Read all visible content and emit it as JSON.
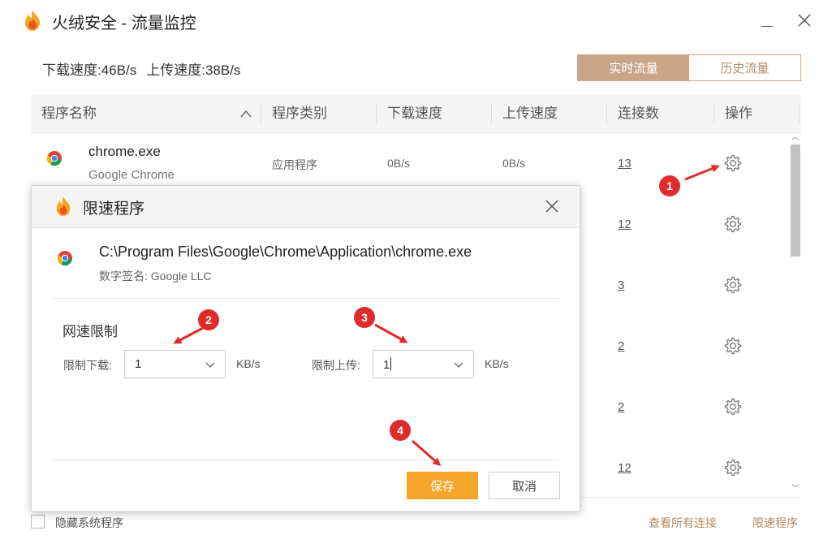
{
  "window": {
    "title": "火绒安全 - 流量监控",
    "logo_icon": "huorong-flame-icon",
    "min_icon": "minimize-icon",
    "close_icon": "close-icon"
  },
  "status": {
    "download_label": "下载速度:",
    "download_value": "46B/s",
    "upload_label": "上传速度:",
    "upload_value": "38B/s"
  },
  "tabs": [
    {
      "label": "实时流量",
      "active": true
    },
    {
      "label": "历史流量",
      "active": false
    }
  ],
  "table": {
    "headers": [
      "程序名称",
      "程序类别",
      "下载速度",
      "上传速度",
      "连接数",
      "操作"
    ],
    "rows": [
      {
        "name": "chrome.exe",
        "subtitle": "Google Chrome",
        "category": "应用程序",
        "download": "0B/s",
        "upload": "0B/s",
        "connections": "13"
      },
      {
        "connections": "12"
      },
      {
        "connections": "3"
      },
      {
        "connections": "2"
      },
      {
        "connections": "2"
      },
      {
        "connections": "12"
      }
    ],
    "action_icon": "gear-icon"
  },
  "bottom": {
    "hide_system_label": "隐藏系统程序",
    "hide_system_checked": false,
    "view_all_link": "查看所有连接",
    "limit_link": "限速程序"
  },
  "dialog": {
    "title": "限速程序",
    "path": "C:\\Program Files\\Google\\Chrome\\Application\\chrome.exe",
    "signature": "数字签名: Google LLC",
    "section_title": "网速限制",
    "download_label": "限制下载:",
    "download_value": "1",
    "upload_label": "限制上传:",
    "upload_value": "1",
    "unit": "KB/s",
    "save_label": "保存",
    "cancel_label": "取消"
  },
  "annotations": [
    "1",
    "2",
    "3",
    "4"
  ],
  "colors": {
    "accent": "#c9a68a",
    "link": "#b68b62",
    "save_button": "#f7a52a",
    "annotation": "#e02b2b"
  }
}
